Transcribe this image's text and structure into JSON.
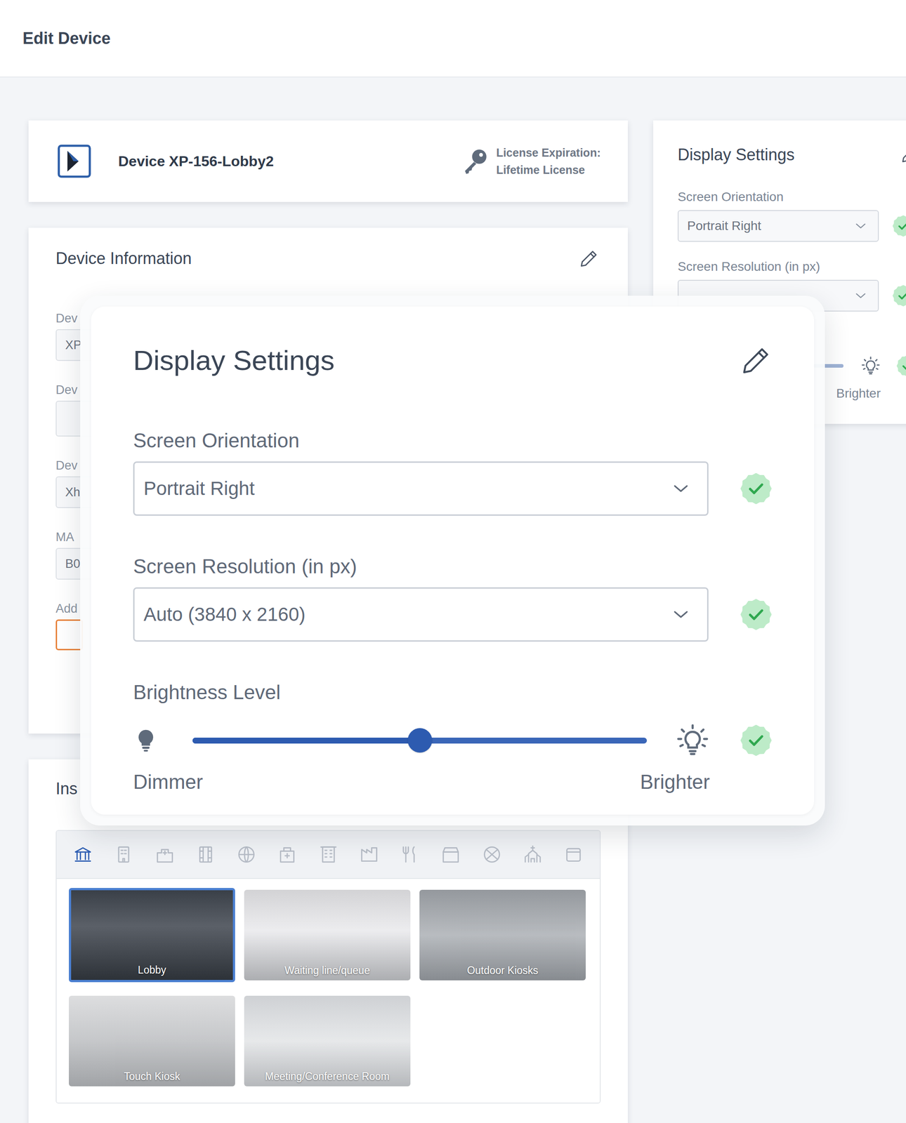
{
  "header": {
    "title": "Edit Device"
  },
  "device_card": {
    "name": "Device XP-156-Lobby2",
    "license_label": "License Expiration:",
    "license_value": "Lifetime License"
  },
  "device_info": {
    "title": "Device Information",
    "fields": [
      {
        "label": "Dev",
        "value": "XP",
        "kind": "input"
      },
      {
        "label": "Dev",
        "value": "",
        "kind": "textarea"
      },
      {
        "label": "Dev",
        "value": "Xh",
        "kind": "input"
      },
      {
        "label": "MA",
        "value": "B0",
        "kind": "input"
      },
      {
        "label": "Add",
        "value": "",
        "kind": "button"
      }
    ]
  },
  "installation": {
    "title": "Ins",
    "types": [
      {
        "selected": true
      },
      {
        "selected": false
      },
      {
        "selected": false
      },
      {
        "selected": false
      },
      {
        "selected": false
      },
      {
        "selected": false
      },
      {
        "selected": false
      },
      {
        "selected": false
      },
      {
        "selected": false
      },
      {
        "selected": false
      },
      {
        "selected": false
      },
      {
        "selected": false
      },
      {
        "selected": false
      }
    ],
    "places": [
      {
        "label": "Lobby",
        "selected": true
      },
      {
        "label": "Waiting line/queue",
        "selected": false
      },
      {
        "label": "Outdoor Kiosks",
        "selected": false
      },
      {
        "label": "Touch Kiosk",
        "selected": false
      },
      {
        "label": "Meeting/Conference Room",
        "selected": false
      }
    ]
  },
  "display_settings_bg": {
    "title": "Display Settings",
    "orientation_label": "Screen Orientation",
    "orientation": "Portrait Right",
    "orientation_confirmed": true,
    "resolution_label": "Screen Resolution (in px)",
    "resolution_confirmed": true,
    "brighter_label": "Brighter",
    "brightness_confirmed": true
  },
  "display_settings": {
    "title": "Display Settings",
    "orientation_label": "Screen Orientation",
    "orientation": "Portrait Right",
    "orientation_confirmed": true,
    "resolution_label": "Screen Resolution (in px)",
    "resolution": "Auto (3840 x 2160)",
    "resolution_confirmed": true,
    "brightness_label": "Brightness Level",
    "brightness": 0.5,
    "brightness_confirmed": true,
    "dimmer_label": "Dimmer",
    "brighter_label": "Brighter"
  }
}
